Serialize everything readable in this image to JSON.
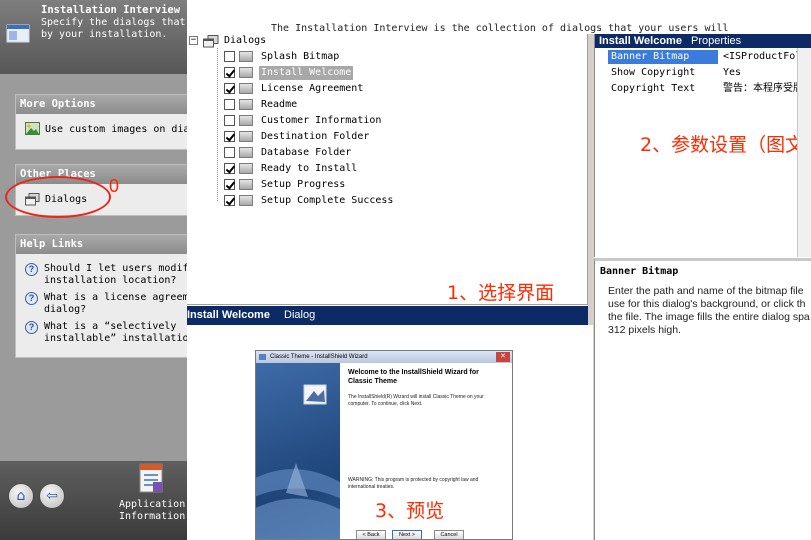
{
  "header": {
    "title": "Installation Interview",
    "subtitle": "Specify the dialogs that are shown\nby your installation."
  },
  "top_description": "The Installation Interview is the collection of dialogs that your users will",
  "sidebar": {
    "more_options": {
      "title": "More Options",
      "items": [
        {
          "label": "Use custom images on dia"
        }
      ]
    },
    "other_places": {
      "title": "Other Places",
      "items": [
        {
          "label": "Dialogs"
        }
      ]
    },
    "help_links": {
      "title": "Help Links",
      "items": [
        {
          "label": "Should I let users modif\ninstallation location?"
        },
        {
          "label": "What is a license agreem\ndialog?"
        },
        {
          "label": "What is a “selectively\ninstallable” installatio"
        }
      ]
    },
    "app_info_label": "Application\nInformation"
  },
  "annotations": {
    "a0": "0",
    "a1": "1、选择界面",
    "a2": "2、参数设置（图文",
    "a3": "3、预览"
  },
  "tree": {
    "root": "Dialogs",
    "items": [
      {
        "label": "Splash Bitmap",
        "checked": false,
        "selected": false
      },
      {
        "label": "Install Welcome",
        "checked": true,
        "selected": true
      },
      {
        "label": "License Agreement",
        "checked": true,
        "selected": false
      },
      {
        "label": "Readme",
        "checked": false,
        "selected": false
      },
      {
        "label": "Customer Information",
        "checked": false,
        "selected": false
      },
      {
        "label": "Destination Folder",
        "checked": true,
        "selected": false
      },
      {
        "label": "Database Folder",
        "checked": false,
        "selected": false
      },
      {
        "label": "Ready to Install",
        "checked": true,
        "selected": false
      },
      {
        "label": "Setup Progress",
        "checked": true,
        "selected": false
      },
      {
        "label": "Setup Complete Success",
        "checked": true,
        "selected": false
      }
    ]
  },
  "preview": {
    "bar_title": "Install Welcome",
    "bar_sub": "Dialog",
    "window_title": "Classic Theme - InstallShield Wizard",
    "heading": "Welcome to the InstallShield Wizard for\nClassic Theme",
    "text1": "The InstallShield(R) Wizard will install Classic Theme on your\ncomputer. To continue, click Next.",
    "text2": "WARNING: This program is protected by copyright law and\ninternational treaties.",
    "buttons": {
      "back": "< Back",
      "next": "Next >",
      "cancel": "Cancel"
    }
  },
  "properties": {
    "title": "Install Welcome",
    "sub": "Properties",
    "rows": [
      {
        "name": "Banner Bitmap",
        "value": "<ISProductFolde",
        "selected": true
      },
      {
        "name": "Show Copyright",
        "value": "Yes",
        "selected": false
      },
      {
        "name": "Copyright Text",
        "value": "警告：本程序受版",
        "selected": false
      }
    ]
  },
  "property_description": {
    "title": "Banner Bitmap",
    "body": "Enter the path and name of the bitmap file\nuse for this dialog's background, or click th\nthe file. The image fills the entire dialog spa\n312 pixels high."
  },
  "colors": {
    "accent_dark_blue": "#0c2a66",
    "selection_blue": "#3a7bdc",
    "annotation_red": "#ff2a00"
  }
}
